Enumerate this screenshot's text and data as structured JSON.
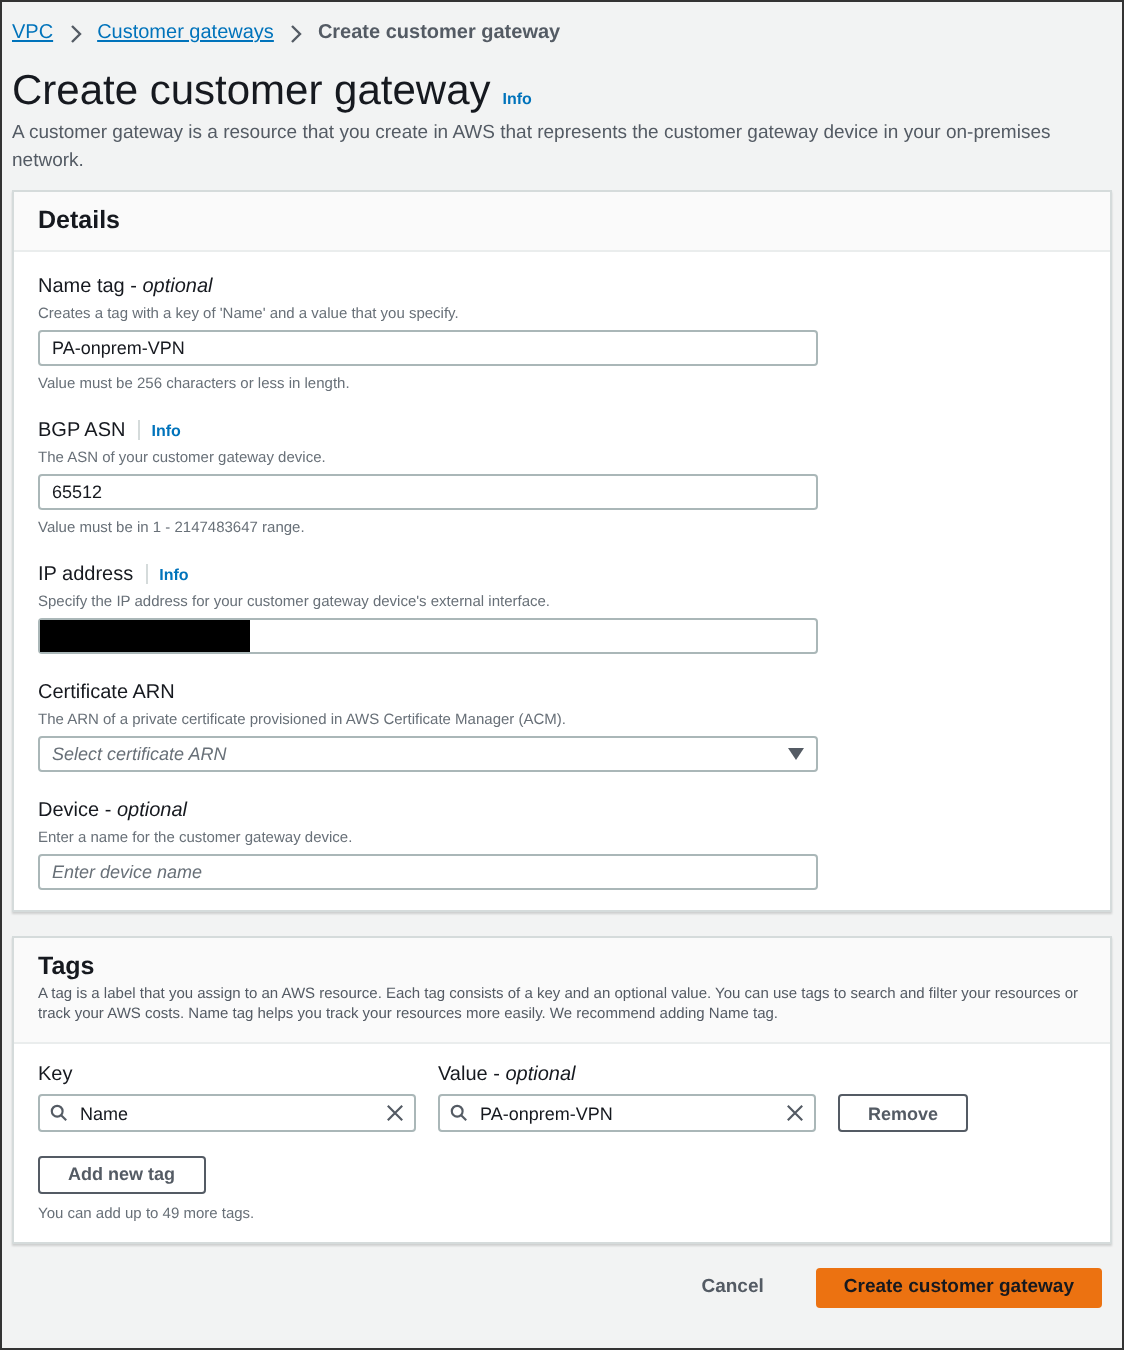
{
  "breadcrumbs": [
    {
      "label": "VPC",
      "link": true
    },
    {
      "label": "Customer gateways",
      "link": true
    },
    {
      "label": "Create customer gateway",
      "link": false
    }
  ],
  "page": {
    "title": "Create customer gateway",
    "info": "Info",
    "description": "A customer gateway is a resource that you create in AWS that represents the customer gateway device in your on-premises network."
  },
  "details": {
    "title": "Details",
    "fields": [
      {
        "kind": "text",
        "label": "Name tag - *optional*",
        "description": "Creates a tag with a key of 'Name' and a value that you specify.",
        "value": "PA-onprem-VPN",
        "constraint": "Value must be 256 characters or less in length."
      },
      {
        "kind": "text",
        "label": "BGP ASN",
        "info": "Info",
        "description": "The ASN of your customer gateway device.",
        "value": "65512",
        "constraint": "Value must be in 1 - 2147483647 range."
      },
      {
        "kind": "redacted",
        "label": "IP address",
        "info": "Info",
        "description": "Specify the IP address for your customer gateway device's external interface."
      },
      {
        "kind": "select",
        "label": "Certificate ARN",
        "description": "The ARN of a private certificate provisioned in AWS Certificate Manager (ACM).",
        "placeholder": "Select certificate ARN"
      },
      {
        "kind": "text",
        "label": "Device - *optional*",
        "description": "Enter a name for the customer gateway device.",
        "placeholder": "Enter device name"
      }
    ]
  },
  "tags": {
    "title": "Tags",
    "description": "A tag is a label that you assign to an AWS resource. Each tag consists of a key and an optional value. You can use tags to search and filter your resources or track your AWS costs. Name tag helps you track your resources more easily. We recommend adding Name tag.",
    "key_label": "Key",
    "value_label": "Value - *optional*",
    "rows": [
      {
        "key": "Name",
        "value": "PA-onprem-VPN",
        "remove": "Remove"
      }
    ],
    "add_button": "Add new tag",
    "limit_note": "You can add up to 49 more tags."
  },
  "footer": {
    "cancel": "Cancel",
    "submit": "Create customer gateway"
  }
}
